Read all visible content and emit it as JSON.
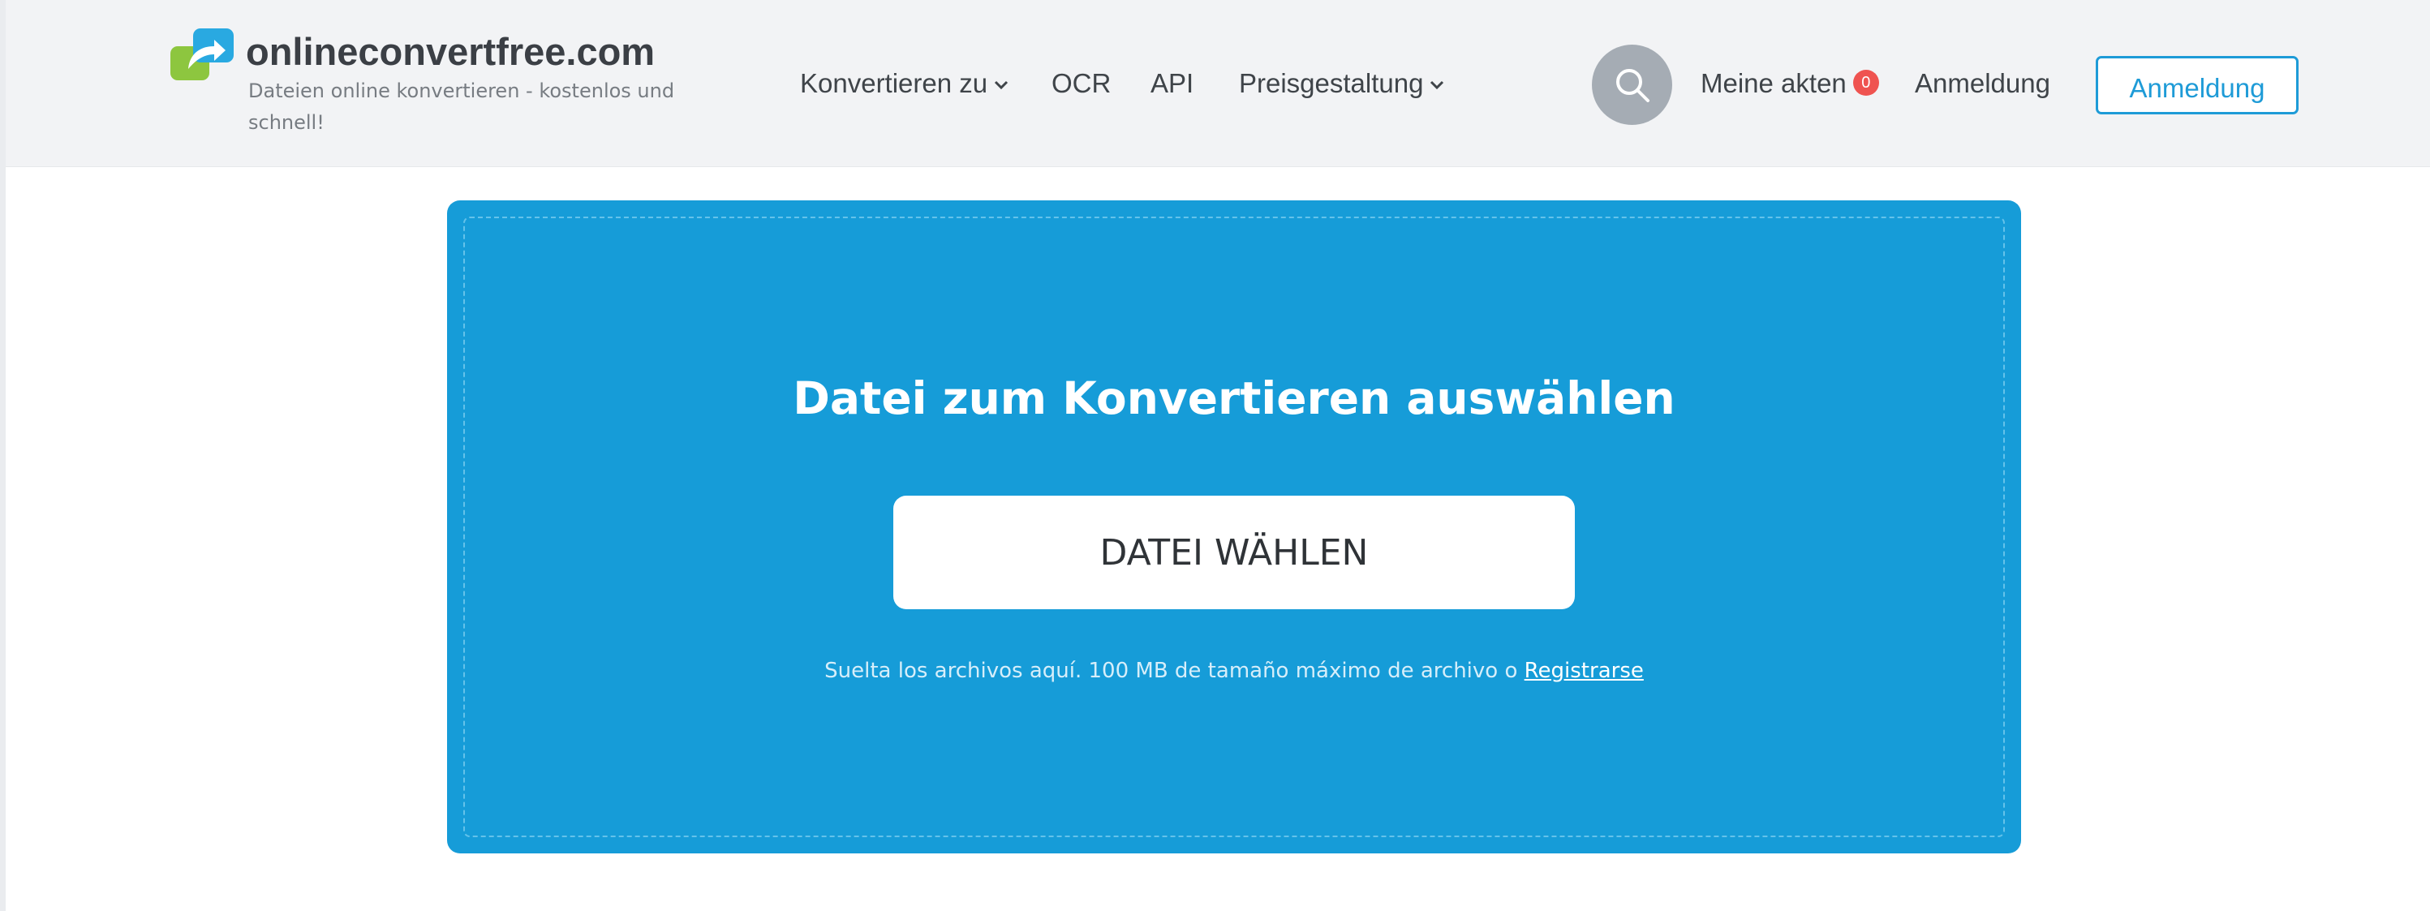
{
  "brand": {
    "name": "onlineconvertfree.com",
    "tagline": "Dateien online konvertieren - kostenlos und schnell!",
    "colors": {
      "green": "#8dc63f",
      "blue": "#29a9e1"
    }
  },
  "nav": {
    "items": [
      {
        "label": "Konvertieren zu",
        "has_dropdown": true
      },
      {
        "label": "OCR",
        "has_dropdown": false
      },
      {
        "label": "API",
        "has_dropdown": false
      },
      {
        "label": "Preisgestaltung",
        "has_dropdown": true
      }
    ]
  },
  "header_actions": {
    "search_icon": "magnifier-icon",
    "my_files_label": "Meine akten",
    "my_files_count": "0",
    "login_label": "Anmeldung",
    "signup_label": "Anmeldung"
  },
  "upload": {
    "title": "Datei zum Konvertieren auswählen",
    "button_label": "DATEI WÄHLEN",
    "helper_text": "Suelta los archivos aquí. 100 MB de tamaño máximo de archivo o ",
    "register_link": "Registrarse",
    "colors": {
      "panel": "#169cd8",
      "button": "#ffffff"
    }
  }
}
